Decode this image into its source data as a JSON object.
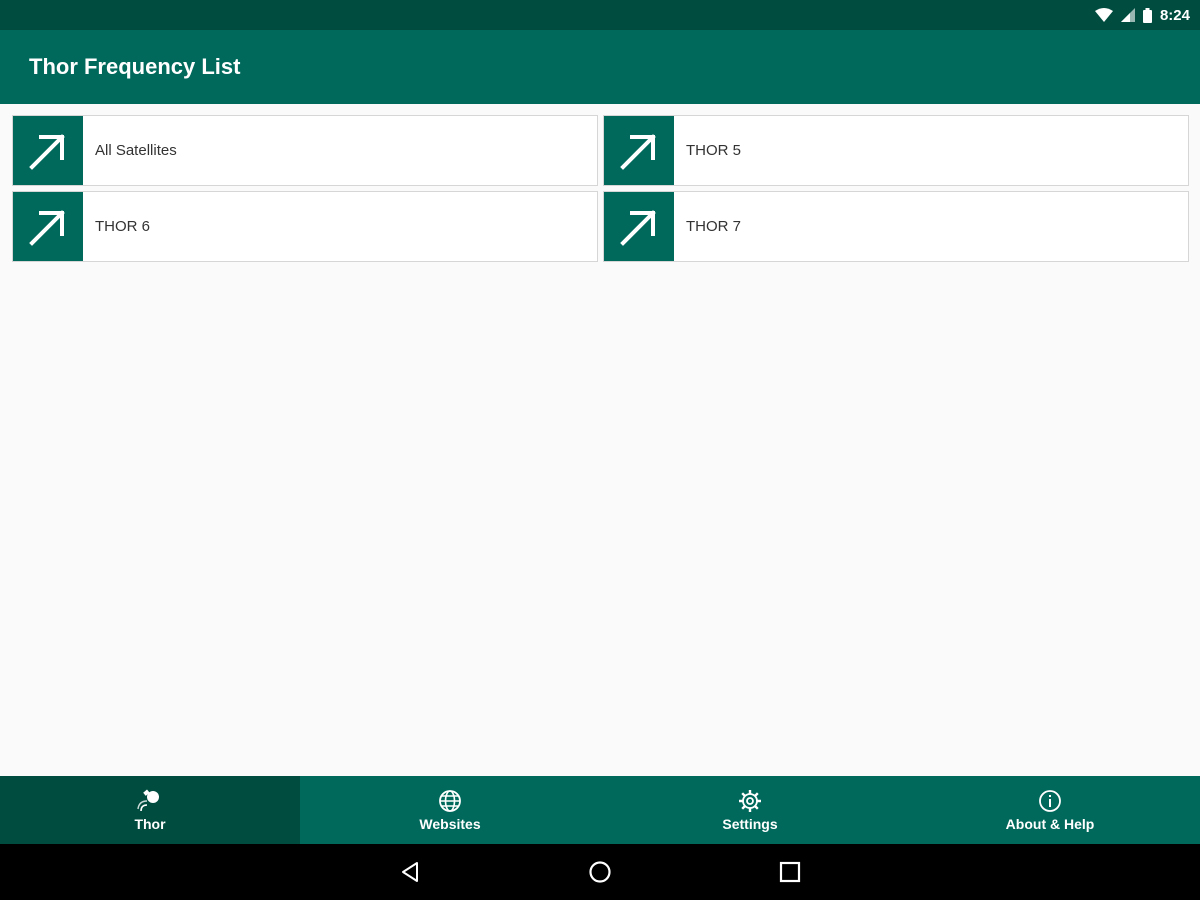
{
  "status_bar": {
    "time": "8:24",
    "icons": [
      "wifi-icon",
      "signal-icon",
      "battery-icon"
    ]
  },
  "app_bar": {
    "title": "Thor Frequency List"
  },
  "tiles": [
    {
      "label": "All Satellites",
      "icon": "arrow-up-right-icon"
    },
    {
      "label": "THOR 5",
      "icon": "arrow-up-right-icon"
    },
    {
      "label": "THOR 6",
      "icon": "arrow-up-right-icon"
    },
    {
      "label": "THOR 7",
      "icon": "arrow-up-right-icon"
    }
  ],
  "bottom_nav": {
    "items": [
      {
        "label": "Thor",
        "icon": "satellite-icon",
        "active": true
      },
      {
        "label": "Websites",
        "icon": "globe-icon",
        "active": false
      },
      {
        "label": "Settings",
        "icon": "gear-icon",
        "active": false
      },
      {
        "label": "About & Help",
        "icon": "info-icon",
        "active": false
      }
    ]
  },
  "system_nav": {
    "icons": [
      "back-icon",
      "home-icon",
      "recents-icon"
    ]
  },
  "colors": {
    "primary": "#00695c",
    "primary_dark": "#004d40",
    "background": "#fafafa"
  }
}
